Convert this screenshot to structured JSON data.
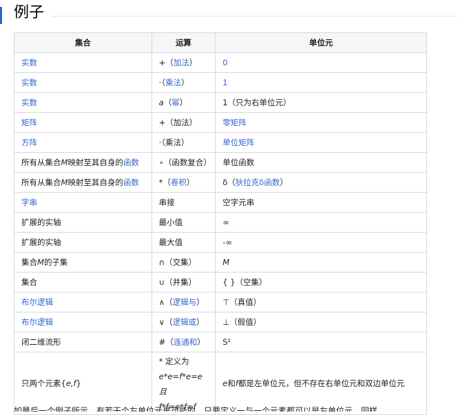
{
  "section": {
    "title": "例子"
  },
  "table": {
    "headers": [
      "集合",
      "运算",
      "单位元"
    ],
    "rows": [
      {
        "set": "实数",
        "op_pre": "+（",
        "op_link": "加法",
        "op_post": "）",
        "unit": "0"
      },
      {
        "set": "实数",
        "op_pre": "·（",
        "op_link": "乘法",
        "op_post": "）",
        "unit": "1"
      },
      {
        "set": "实数",
        "op_var": "a",
        "op_pre": "（",
        "op_link": "幂",
        "op_post": "）",
        "unit": "1（只为右单位元）"
      },
      {
        "set": "矩阵",
        "op_pre": "+（加法）",
        "unit": "零矩阵"
      },
      {
        "set": "方阵",
        "op_pre": "·（乘法）",
        "unit": "单位矩阵"
      },
      {
        "set_pre": "所有从集合",
        "set_var": "M",
        "set_mid": "映射至其自身的",
        "set_link": "函数",
        "op_pre": "∘（函数复合）",
        "unit": "单位函数"
      },
      {
        "set_pre": "所有从集合",
        "set_var": "M",
        "set_mid": "映射至其自身的",
        "set_link": "函数",
        "op_pre": "*（",
        "op_link": "卷积",
        "op_post": "）",
        "unit_pre": "δ（",
        "unit_link": "狄拉克δ函数",
        "unit_post": "）"
      },
      {
        "set": "字串",
        "op_pre": "串接",
        "unit": "空字元串"
      },
      {
        "set": "扩展的实轴",
        "op_pre": "最小值",
        "unit": "∞"
      },
      {
        "set": "扩展的实轴",
        "op_pre": "最大值",
        "unit": "-∞"
      },
      {
        "set_pre": "集合",
        "set_var": "M",
        "set_mid": "的子集",
        "op_pre": "∩（交集）",
        "unit_var": "M"
      },
      {
        "set": "集合",
        "op_pre": "∪（并集）",
        "unit": "{ }（空集）"
      },
      {
        "set": "布尔逻辑",
        "op_pre": "∧（",
        "op_link": "逻辑与",
        "op_post": "）",
        "unit": "⊤（真值）"
      },
      {
        "set": "布尔逻辑",
        "op_pre": "∨（",
        "op_link": "逻辑或",
        "op_post": "）",
        "unit": "⊥（假值）"
      },
      {
        "set": "闭二维流形",
        "op_pre": "#（",
        "op_link": "连通和",
        "op_post": "）",
        "unit": "S²"
      },
      {
        "set_pre": "只两个元素{",
        "set_var": "e,f",
        "set_mid": "}",
        "op_lines": [
          "* 定义为",
          "e*e=f*e=e且",
          "f*f=e*f=f"
        ],
        "unit_var": "e",
        "unit_mid": "和",
        "unit_var2": "f",
        "unit_post": "都是左单位元，但不存在右单位元和双边单位元"
      }
    ]
  },
  "cut_text": "如最后一个例子所示，有若干个左单位元是可能的，只要定义一与一个元素都可以是左单位元，同样"
}
